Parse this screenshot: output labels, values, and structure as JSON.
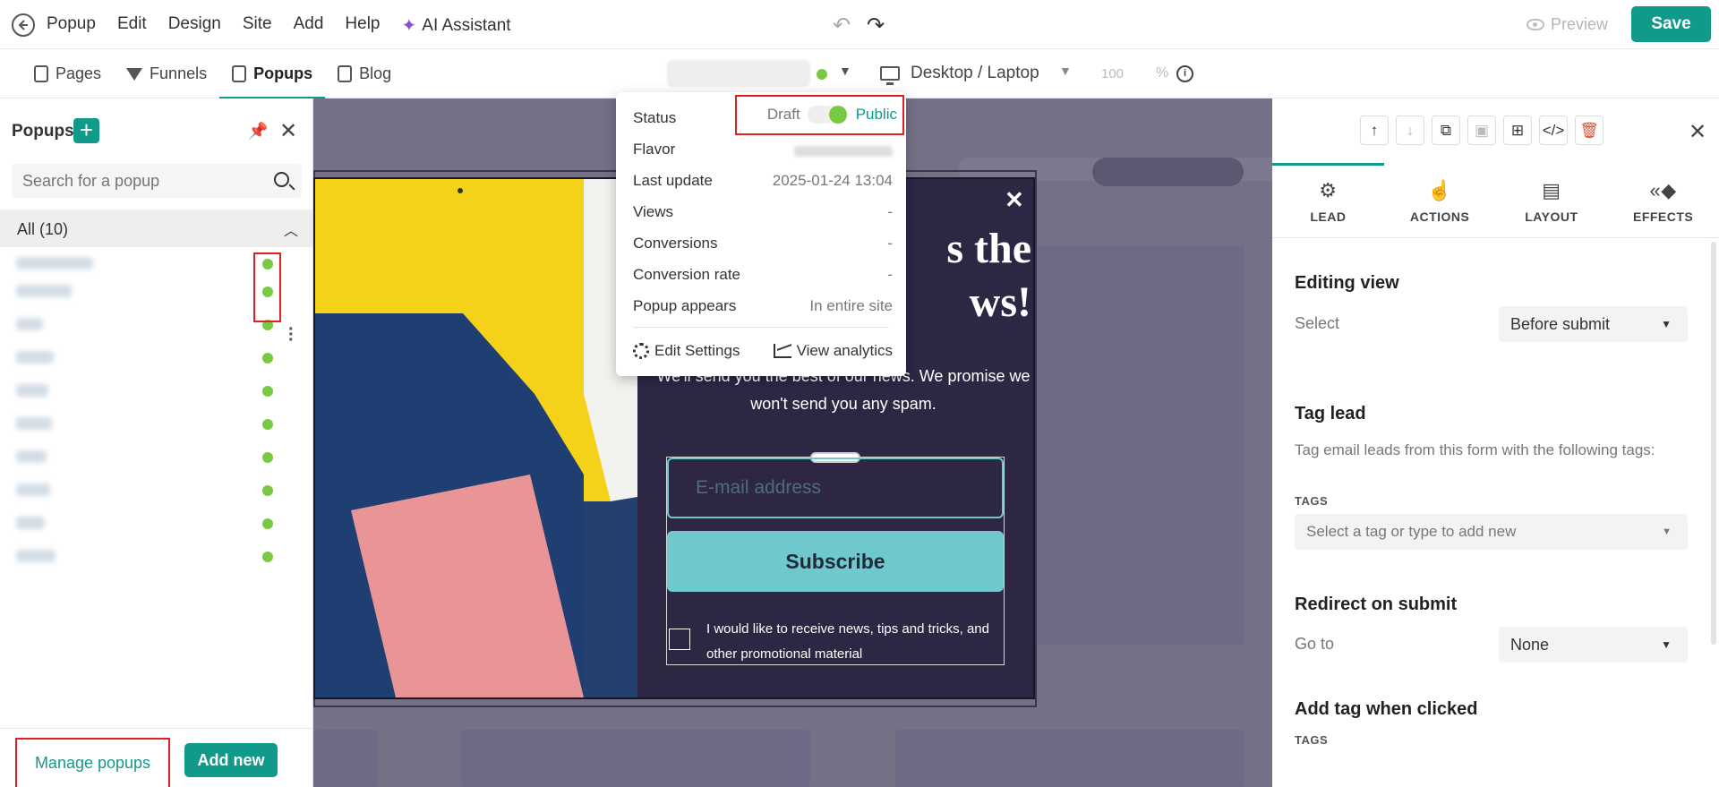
{
  "menu": {
    "items": [
      "Popup",
      "Edit",
      "Design",
      "Site",
      "Add",
      "Help"
    ],
    "ai_label": "AI Assistant",
    "preview_label": "Preview",
    "save_label": "Save"
  },
  "nav": {
    "tabs": [
      {
        "label": "Pages",
        "active": false
      },
      {
        "label": "Funnels",
        "active": false
      },
      {
        "label": "Popups",
        "active": true
      },
      {
        "label": "Blog",
        "active": false
      }
    ],
    "device_label": "Desktop / Laptop",
    "zoom_value": "100",
    "zoom_unit": "%"
  },
  "sidebar": {
    "title": "Popups",
    "search_placeholder": "Search for a popup",
    "group_label": "All (10)",
    "manage_label": "Manage popups",
    "add_new_label": "Add new"
  },
  "popup": {
    "headline": "s the\nws!",
    "subtext": "We'll send you the best of our news. We promise we won't send you any spam.",
    "email_placeholder": "E-mail address",
    "subscribe_label": "Subscribe",
    "consent": "I would like to receive news, tips and tricks, and other promotional material"
  },
  "popover": {
    "status_label": "Status",
    "draft_label": "Draft",
    "public_label": "Public",
    "flavor_label": "Flavor",
    "last_update_label": "Last update",
    "last_update_value": "2025-01-24 13:04",
    "views_label": "Views",
    "views_value": "-",
    "conversions_label": "Conversions",
    "conversions_value": "-",
    "conversion_rate_label": "Conversion rate",
    "conversion_rate_value": "-",
    "appears_label": "Popup appears",
    "appears_value": "In entire site",
    "edit_settings_label": "Edit Settings",
    "view_analytics_label": "View analytics"
  },
  "right_panel": {
    "tabs": [
      "LEAD",
      "ACTIONS",
      "LAYOUT",
      "EFFECTS"
    ],
    "editing_view_title": "Editing view",
    "editing_view_label": "Select",
    "editing_view_value": "Before submit",
    "tag_lead_title": "Tag lead",
    "tag_lead_desc": "Tag email leads from this form with the following tags:",
    "tags_label": "TAGS",
    "tag_placeholder": "Select a tag or type to add new",
    "redirect_title": "Redirect on submit",
    "redirect_label": "Go to",
    "redirect_value": "None",
    "add_tag_title": "Add tag when clicked",
    "tags_label_2": "TAGS"
  },
  "colors": {
    "accent": "#11998a",
    "status_green": "#7ac943",
    "highlight_red": "#e02020",
    "canvas_bg": "#767087",
    "popup_bg": "#2d2744",
    "button_teal": "#6fc9cc"
  }
}
